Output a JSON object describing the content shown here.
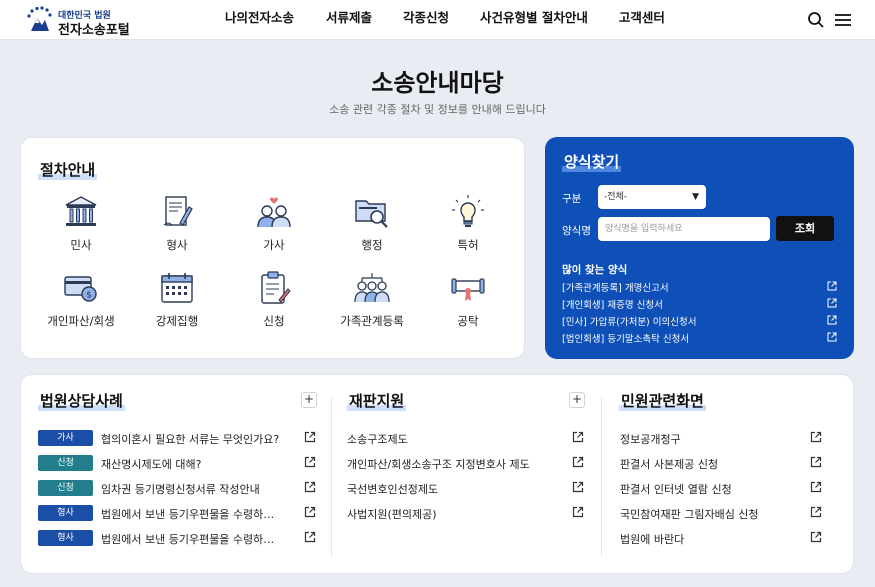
{
  "header": {
    "logo_sub": "대한민국 법원",
    "logo_main": "전자소송포털",
    "nav": [
      "나의전자소송",
      "서류제출",
      "각종신청",
      "사건유형별 절차안내",
      "고객센터"
    ]
  },
  "hero": {
    "title": "소송안내마당",
    "subtitle": "소송 관련 각종 절차 및 정보를 안내해 드립니다"
  },
  "procedures": {
    "title": "절차안내",
    "items": [
      {
        "label": "민사",
        "icon": "courthouse-icon"
      },
      {
        "label": "형사",
        "icon": "document-pen-icon"
      },
      {
        "label": "가사",
        "icon": "family-icon"
      },
      {
        "label": "행정",
        "icon": "folder-search-icon"
      },
      {
        "label": "특허",
        "icon": "lightbulb-icon"
      },
      {
        "label": "개인파산/회생",
        "icon": "card-coin-icon"
      },
      {
        "label": "강제집행",
        "icon": "calendar-icon"
      },
      {
        "label": "신청",
        "icon": "clipboard-icon"
      },
      {
        "label": "가족관계등록",
        "icon": "people-group-icon"
      },
      {
        "label": "공탁",
        "icon": "scroll-icon"
      }
    ]
  },
  "finder": {
    "title": "양식찾기",
    "category_label": "구분",
    "category_value": "-전체-",
    "name_label": "양식명",
    "name_placeholder": "양식명을 입력하세요",
    "search_button": "조회",
    "popular_title": "많이 찾는 양식",
    "popular": [
      "[가족관계등록] 개명신고서",
      "[개인회생] 재증명 신청서",
      "[민사] 가압류(가처분) 이의신청서",
      "[법인회생] 등기말소촉탁 신청서"
    ]
  },
  "cases": {
    "title": "법원상담사례",
    "plus": "+",
    "items": [
      {
        "tag": "가사",
        "color": "#1b4ea6",
        "text": "협의이혼시 필요한 서류는 무엇인가요?"
      },
      {
        "tag": "신청",
        "color": "#227e8c",
        "text": "재산명시제도에 대해?"
      },
      {
        "tag": "신청",
        "color": "#227e8c",
        "text": "임차권 등기명령신청서류 작성안내"
      },
      {
        "tag": "형사",
        "color": "#1b4ea6",
        "text": "법원에서 보낸 등기우편물을 수령하…"
      },
      {
        "tag": "형사",
        "color": "#1b4ea6",
        "text": "법원에서 보낸 등기우편물을 수령하…"
      }
    ]
  },
  "support": {
    "title": "재판지원",
    "plus": "+",
    "items": [
      "소송구조제도",
      "개인파산/회생소송구조 지정변호사 제도",
      "국선변호인선정제도",
      "사법지원(편의제공)"
    ]
  },
  "civil": {
    "title": "민원관련화면",
    "items": [
      "정보공개청구",
      "판결서 사본제공 신청",
      "판결서 인터넷 열람 신청",
      "국민참여재판 그림자배심 신청",
      "법원에 바란다"
    ]
  },
  "colors": {
    "brand_blue": "#0e4fb8",
    "tag_blue": "#1b4ea6",
    "tag_teal": "#227e8c"
  }
}
